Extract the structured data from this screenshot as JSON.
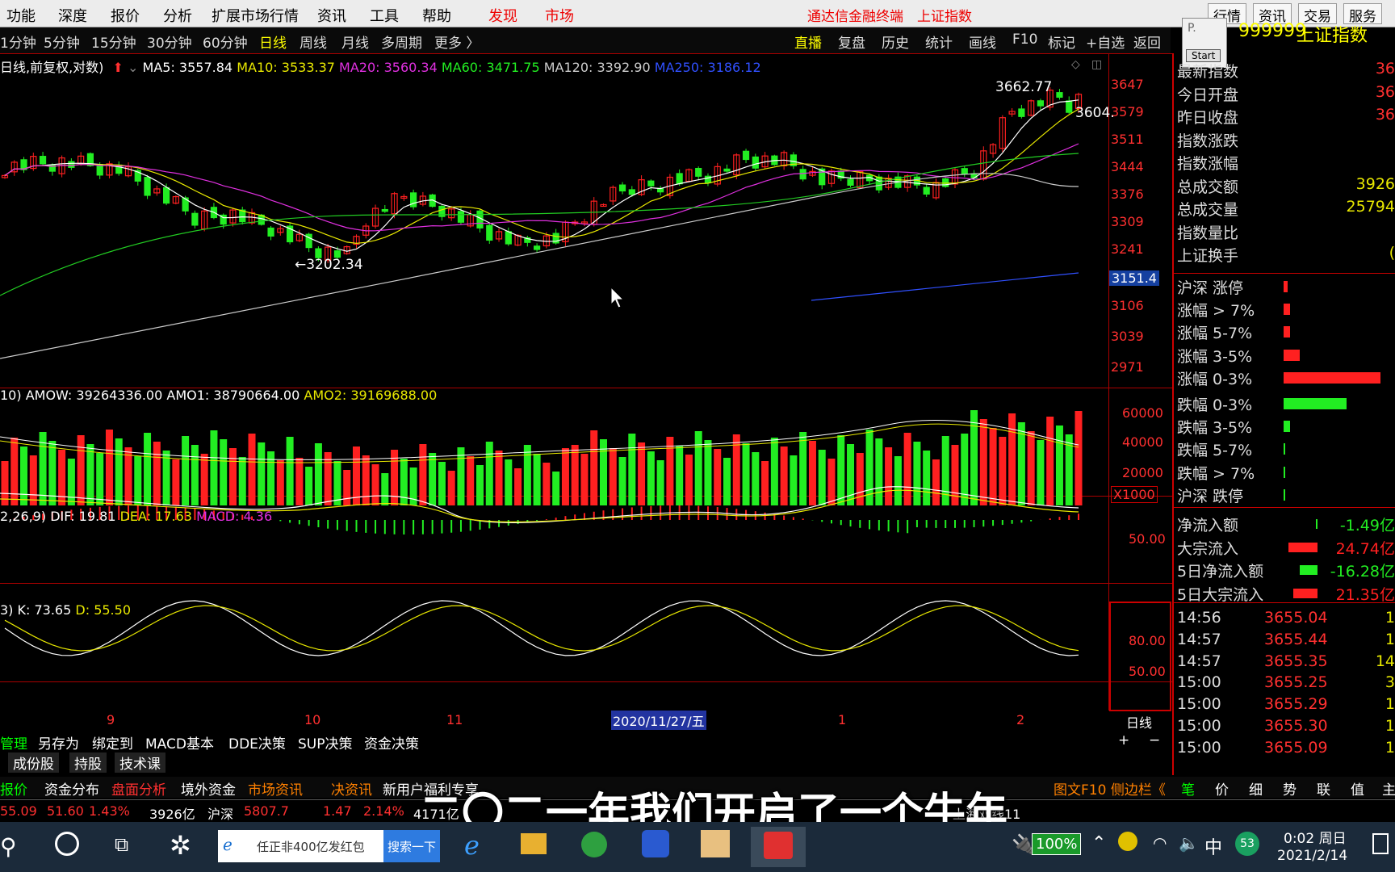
{
  "menu": {
    "items": [
      "功能",
      "深度",
      "报价",
      "分析",
      "扩展市场行情",
      "资讯",
      "工具",
      "帮助"
    ],
    "highlight": [
      "发现",
      "市场"
    ],
    "title": "通达信金融终端",
    "index_name": "上证指数",
    "right_tabs": [
      "行情",
      "资讯",
      "交易",
      "服务"
    ],
    "popup_title": "P.",
    "popup_button": "Start"
  },
  "periods": [
    "1分钟",
    "5分钟",
    "15分钟",
    "30分钟",
    "60分钟",
    "日线",
    "周线",
    "月线",
    "多周期",
    "更多 〉"
  ],
  "tools": [
    "直播",
    "复盘",
    "历史",
    "统计",
    "画线",
    "F10",
    "标记",
    "+自选",
    "返回"
  ],
  "ma_line": {
    "prefix": "日线,前复权,对数)",
    "ma5": "MA5: 3557.84",
    "ma10": "MA10: 3533.37",
    "ma20": "MA20: 3560.34",
    "ma60": "MA60: 3471.75",
    "ma120": "MA120: 3392.90",
    "ma250": "MA250: 3186.12"
  },
  "price_axis": [
    "3647",
    "3579",
    "3511",
    "3444",
    "3376",
    "3309",
    "3241",
    "3151.4",
    "3106",
    "3039",
    "2971"
  ],
  "annotations": {
    "high": "3662.77",
    "low": "←3202.34",
    "current": "3604."
  },
  "volume": {
    "label": "10)",
    "amow": "AMOW: 39264336.00",
    "amo1": "AMO1: 38790664.00",
    "amo2": "AMO2: 39169688.00",
    "axis": [
      "60000",
      "40000",
      "20000",
      "X1000"
    ]
  },
  "macd": {
    "label": "2,26,9)",
    "dif": "DIF: 19.81",
    "dea": "DEA: 17.63",
    "macd": "MACD: 4.36",
    "axis": [
      "50.00"
    ]
  },
  "kd": {
    "label": "3)",
    "k": "K: 73.65",
    "d": "D: 55.50",
    "axis": [
      "80.00",
      "50.00"
    ]
  },
  "x_axis": {
    "labels": [
      "9",
      "10",
      "11",
      "2020/11/27/五",
      "1",
      "2"
    ],
    "period": "日线",
    "plus": "+",
    "minus": "−"
  },
  "bottom_tabs": [
    "管理",
    "另存为",
    "绑定到",
    "MACD基本",
    "DDE决策",
    "SUP决策",
    "资金决策"
  ],
  "sub_tabs": [
    "成份股",
    "持股",
    "技术课"
  ],
  "func_tabs": [
    "报价",
    "资金分布",
    "盘面分析",
    "境外资金",
    "市场资讯",
    "决资讯",
    "新用户福利专享"
  ],
  "func_right": "图文F10 侧边栏《",
  "func_icons": [
    "笔",
    "价",
    "细",
    "势",
    "联",
    "值",
    "主"
  ],
  "right_panel": {
    "code": "999999",
    "name": "上证指数",
    "rows": [
      {
        "label": "最新指数",
        "val": "36"
      },
      {
        "label": "今日开盘",
        "val": "36"
      },
      {
        "label": "昨日收盘",
        "val": "36"
      },
      {
        "label": "指数涨跌",
        "val": ""
      },
      {
        "label": "指数涨幅",
        "val": ""
      },
      {
        "label": "总成交额",
        "val": "3926"
      },
      {
        "label": "总成交量",
        "val": "25794"
      },
      {
        "label": "指数量比",
        "val": ""
      },
      {
        "label": "上证换手",
        "val": "("
      }
    ],
    "bars": [
      {
        "label": "沪深 涨停",
        "w": 5,
        "c": "#ff2020"
      },
      {
        "label": "涨幅 > 7%",
        "w": 8,
        "c": "#ff2020"
      },
      {
        "label": "涨幅 5-7%",
        "w": 8,
        "c": "#ff2020"
      },
      {
        "label": "涨幅 3-5%",
        "w": 20,
        "c": "#ff2020"
      },
      {
        "label": "涨幅 0-3%",
        "w": 120,
        "c": "#ff2020"
      },
      {
        "label": "跌幅 0-3%",
        "w": 78,
        "c": "#22ee22"
      },
      {
        "label": "跌幅 3-5%",
        "w": 8,
        "c": "#22ee22"
      },
      {
        "label": "跌幅 5-7%",
        "w": 2,
        "c": "#22ee22"
      },
      {
        "label": "跌幅 > 7%",
        "w": 2,
        "c": "#22ee22"
      },
      {
        "label": "沪深 跌停",
        "w": 2,
        "c": "#22ee22"
      }
    ],
    "flows": [
      {
        "label": "净流入额",
        "val": "-1.49亿",
        "c": "#22ee22",
        "w": 2
      },
      {
        "label": "大宗流入",
        "val": "24.74亿",
        "c": "#ff2020",
        "w": 36
      },
      {
        "label": "5日净流入额",
        "val": "-16.28亿",
        "c": "#22ee22",
        "w": 22
      },
      {
        "label": "5日大宗流入",
        "val": "21.35亿",
        "c": "#ff2020",
        "w": 30
      }
    ],
    "ticks": [
      {
        "t": "14:56",
        "p": "3655.04",
        "v": "1"
      },
      {
        "t": "14:57",
        "p": "3655.44",
        "v": "1"
      },
      {
        "t": "14:57",
        "p": "3655.35",
        "v": "14"
      },
      {
        "t": "15:00",
        "p": "3655.25",
        "v": "3"
      },
      {
        "t": "15:00",
        "p": "3655.29",
        "v": "1"
      },
      {
        "t": "15:00",
        "p": "3655.30",
        "v": "1"
      },
      {
        "t": "15:00",
        "p": "3655.09",
        "v": "1"
      }
    ]
  },
  "status": {
    "items": [
      "55.09",
      "51.60",
      "1.43%",
      "3926亿",
      "沪深",
      "5807.7",
      "1.47",
      "2.14%",
      "4171亿"
    ],
    "right": "上海双线11"
  },
  "taskbar": {
    "search": "任正非400亿发红包",
    "search_btn": "搜索一下",
    "battery": "100%",
    "ime": "中",
    "badge": "53",
    "time": "0:02 周日",
    "date": "2021/2/14"
  },
  "subtitle": "二〇二一年我们开启了一个牛年",
  "colors": {
    "up": "#ff2020",
    "down": "#22ee22",
    "ma5": "#ffffff",
    "ma10": "#e8e800",
    "ma20": "#e030e0",
    "ma60": "#22cc22",
    "ma120": "#cccccc",
    "ma250": "#3050ff"
  }
}
